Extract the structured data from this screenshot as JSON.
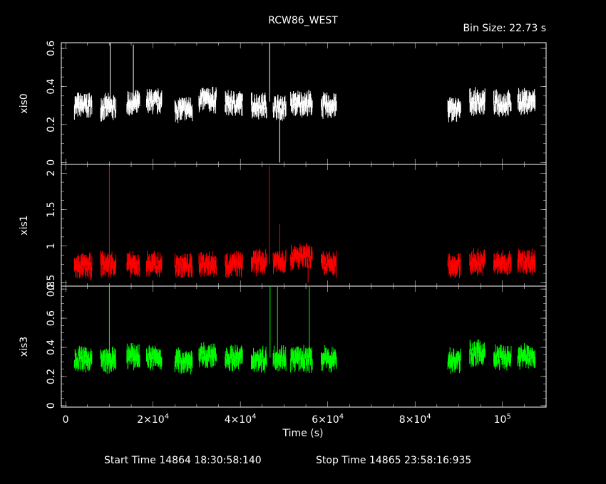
{
  "title": "RCW86_WEST",
  "bin_size_label": "Bin Size: 22.73 s",
  "start_label": "Start Time 14864 18:30:58:140",
  "stop_label": "Stop Time 14865 23:58:16:935",
  "colors": {
    "background": "#000000",
    "axes": "#ffffff",
    "xis0": "#ffffff",
    "xis1": "#ff0000",
    "xis3": "#00ff00"
  },
  "chart_data": {
    "type": "scatter",
    "xlabel": "Time (s)",
    "xlim": [
      -1000,
      110000
    ],
    "xticks": [
      {
        "value": 0,
        "label": "0"
      },
      {
        "value": 20000,
        "label": "2×10",
        "exp": "4"
      },
      {
        "value": 40000,
        "label": "4×10",
        "exp": "4"
      },
      {
        "value": 60000,
        "label": "6×10",
        "exp": "4"
      },
      {
        "value": 80000,
        "label": "8×10",
        "exp": "4"
      },
      {
        "value": 100000,
        "label": "10",
        "exp": "5"
      }
    ],
    "segments": [
      [
        2000,
        6000
      ],
      [
        8000,
        11500
      ],
      [
        14000,
        17000
      ],
      [
        18500,
        22000
      ],
      [
        25000,
        29000
      ],
      [
        30500,
        34500
      ],
      [
        36500,
        40500
      ],
      [
        42500,
        46000
      ],
      [
        47500,
        50500
      ],
      [
        51500,
        56500
      ],
      [
        58500,
        62000
      ],
      [
        87500,
        90500
      ],
      [
        92500,
        96000
      ],
      [
        98000,
        102000
      ],
      [
        103500,
        107500
      ]
    ],
    "panels": [
      {
        "name": "xis0",
        "ylabel": "xis0",
        "color": "#ffffff",
        "ylim": [
          -0.01,
          0.63
        ],
        "yticks": [
          {
            "value": 0,
            "label": "0"
          },
          {
            "value": 0.2,
            "label": "0.2"
          },
          {
            "value": 0.4,
            "label": "0.4"
          },
          {
            "value": 0.6,
            "label": "0.6"
          }
        ],
        "mean": [
          0.3,
          0.29,
          0.31,
          0.32,
          0.28,
          0.33,
          0.31,
          0.3,
          0.29,
          0.31,
          0.3,
          0.28,
          0.32,
          0.31,
          0.32
        ],
        "spikes": [
          {
            "x": 10200,
            "y": 0.63
          },
          {
            "x": 15500,
            "y": 0.62
          },
          {
            "x": 46700,
            "y": 0.63
          },
          {
            "x": 49000,
            "y": 0.0
          }
        ]
      },
      {
        "name": "xis1",
        "ylabel": "xis1",
        "color": "#ff0000",
        "ylim": [
          0.45,
          2.12
        ],
        "yticks": [
          {
            "value": 0.5,
            "label": "0.5"
          },
          {
            "value": 1,
            "label": "1"
          },
          {
            "value": 1.5,
            "label": "1.5"
          },
          {
            "value": 2,
            "label": "2"
          }
        ],
        "mean": [
          0.72,
          0.75,
          0.74,
          0.75,
          0.73,
          0.76,
          0.75,
          0.78,
          0.8,
          0.85,
          0.75,
          0.74,
          0.78,
          0.76,
          0.79
        ],
        "spikes": [
          {
            "x": 10000,
            "y": 2.1
          },
          {
            "x": 46600,
            "y": 2.1
          },
          {
            "x": 49000,
            "y": 1.3
          },
          {
            "x": 55500,
            "y": 0.5
          }
        ]
      },
      {
        "name": "xis3",
        "ylabel": "xis3",
        "color": "#00ff00",
        "ylim": [
          -0.01,
          0.82
        ],
        "yticks": [
          {
            "value": 0,
            "label": "0"
          },
          {
            "value": 0.2,
            "label": "0.2"
          },
          {
            "value": 0.4,
            "label": "0.4"
          },
          {
            "value": 0.6,
            "label": "0.6"
          },
          {
            "value": 0.8,
            "label": "0.8"
          }
        ],
        "mean": [
          0.32,
          0.31,
          0.34,
          0.33,
          0.31,
          0.34,
          0.33,
          0.32,
          0.33,
          0.32,
          0.32,
          0.31,
          0.36,
          0.33,
          0.34
        ],
        "spikes": [
          {
            "x": 10000,
            "y": 0.82
          },
          {
            "x": 46800,
            "y": 0.82
          },
          {
            "x": 48500,
            "y": 0.82
          },
          {
            "x": 55800,
            "y": 0.82
          }
        ]
      }
    ]
  }
}
